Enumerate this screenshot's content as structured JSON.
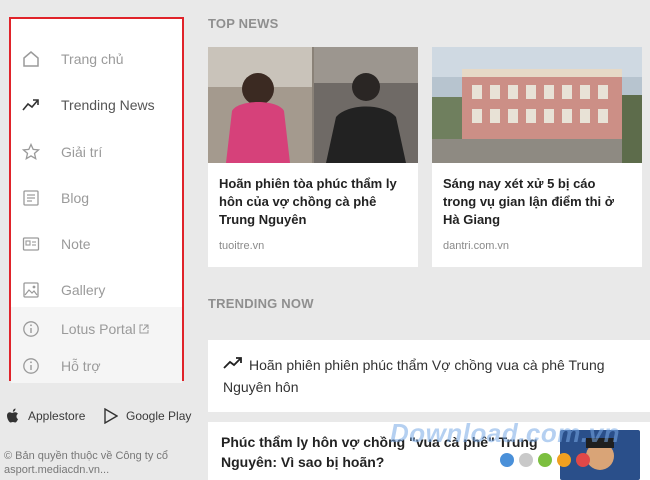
{
  "sidebar": {
    "items": [
      {
        "label": "Trang chủ",
        "icon": "home-icon"
      },
      {
        "label": "Trending News",
        "icon": "trending-up-icon",
        "active": true
      },
      {
        "label": "Giải trí",
        "icon": "star-icon"
      },
      {
        "label": "Blog",
        "icon": "blog-icon"
      },
      {
        "label": "Note",
        "icon": "note-icon"
      },
      {
        "label": "Gallery",
        "icon": "gallery-icon"
      },
      {
        "label": "Lotus Portal",
        "icon": "info-icon",
        "external": true
      },
      {
        "label": "Hỗ trợ",
        "icon": "info-icon"
      }
    ],
    "highlight_color": "#e0232a"
  },
  "stores": {
    "apple_label": "Applestore",
    "google_label": "Google Play"
  },
  "footer": {
    "copyright_line1": "© Bản quyền thuộc về Công ty cổ",
    "copyright_line2": "asport.mediacdn.vn..."
  },
  "main": {
    "top_news_title": "TOP NEWS",
    "cards": [
      {
        "title": "Hoãn phiên tòa phúc thẩm ly hôn của vợ chồng cà phê Trung Nguyên",
        "source": "tuoitre.vn"
      },
      {
        "title": "Sáng nay xét xử 5 bị cáo trong vụ gian lận điểm thi ở Hà Giang",
        "source": "dantri.com.vn"
      }
    ],
    "trending_now_title": "TRENDING NOW",
    "trending_item": "Hoãn phiên phiên phúc thẩm Vợ chồng vua cà phê Trung Nguyên hôn",
    "story_title": "Phúc thẩm ly hôn vợ chồng \"vua cà phê\" Trung Nguyên: Vì sao bị hoãn?",
    "watermark": "Download.com.vn"
  }
}
